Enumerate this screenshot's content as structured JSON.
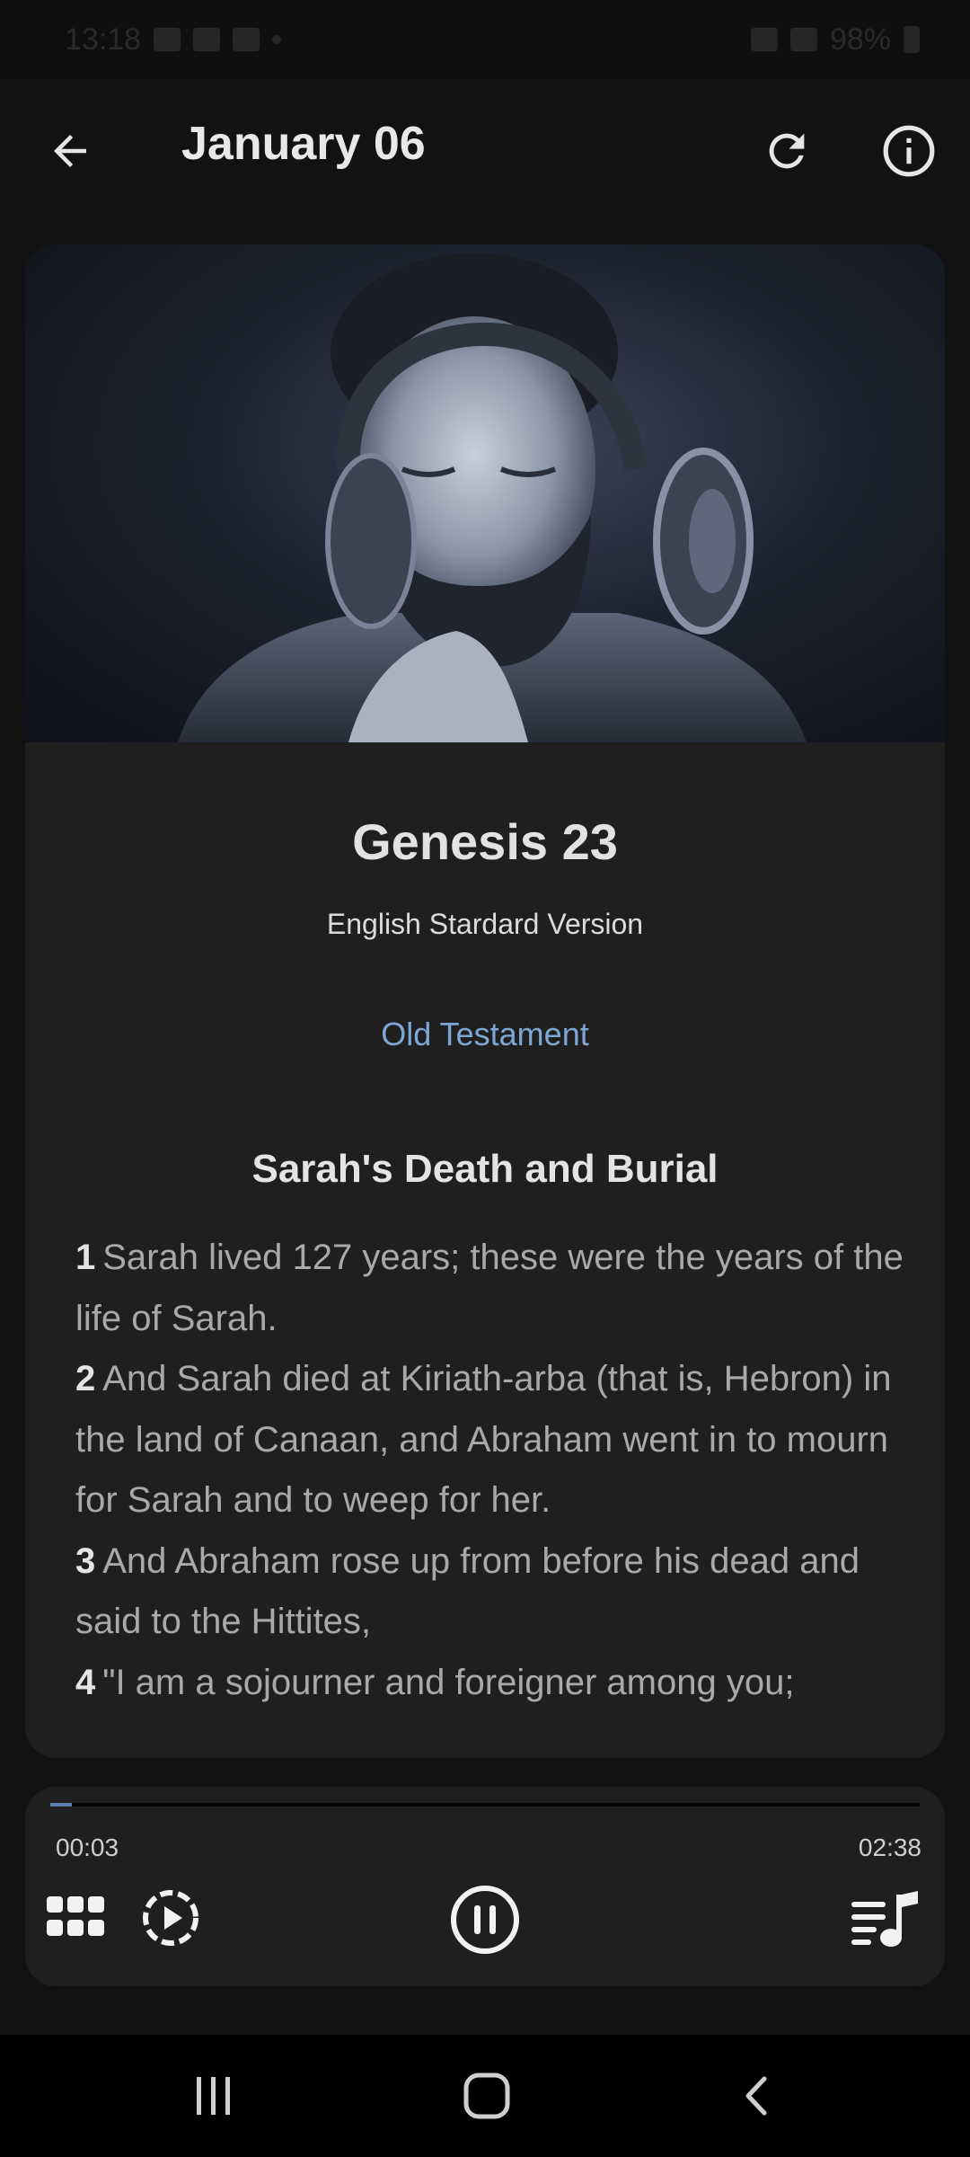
{
  "status_bar": {
    "time": "13:18",
    "battery": "98%"
  },
  "app_bar": {
    "title": "January 06",
    "back_icon": "arrow-left-icon",
    "refresh_icon": "refresh-icon",
    "info_icon": "info-icon"
  },
  "reading": {
    "chapter": "Genesis 23",
    "version": "English Stardard Version",
    "testament": "Old Testament",
    "section_heading": "Sarah's Death and Burial",
    "verses": [
      {
        "num": "1",
        "text": "Sarah lived 127 years; these were the years of the life of Sarah."
      },
      {
        "num": "2",
        "text": "And Sarah died at Kiriath-arba (that is, Hebron) in the land of Canaan, and Abraham went in to mourn for Sarah and to weep for her."
      },
      {
        "num": "3",
        "text": "And Abraham rose up from before his dead and said to the Hittites,"
      },
      {
        "num": "4",
        "text": "\"I am a sojourner and foreigner among you;"
      }
    ]
  },
  "player": {
    "current_time": "00:03",
    "total_time": "02:38",
    "progress": 0.025,
    "accent_color": "#5b7fb0"
  },
  "colors": {
    "background": "#121212",
    "card": "#1f1f1f",
    "link": "#7ea7d6"
  }
}
